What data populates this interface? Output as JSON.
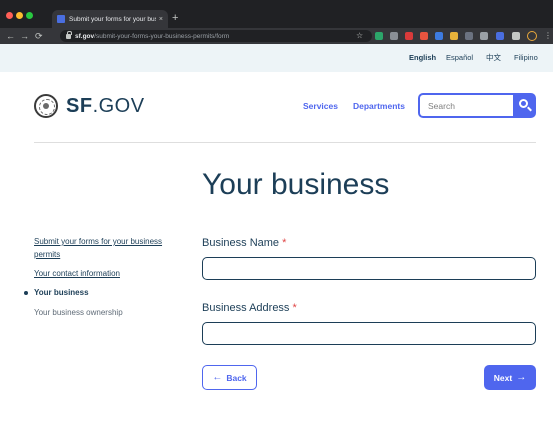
{
  "browser": {
    "tab_title": "Submit your forms for your bus",
    "tab_close": "×",
    "new_tab": "+",
    "url_host": "sf.gov",
    "url_path": "/submit-your-forms-your-business-permits/form"
  },
  "header": {
    "languages": [
      {
        "label": "English",
        "active": true
      },
      {
        "label": "Español",
        "active": false
      },
      {
        "label": "中文",
        "active": false
      },
      {
        "label": "Filipino",
        "active": false
      }
    ],
    "logo_bold": "SF",
    "logo_rest": ".GOV",
    "nav": {
      "services": "Services",
      "departments": "Departments"
    },
    "search_placeholder": "Search"
  },
  "main": {
    "title": "Your business",
    "fields": {
      "business_name": {
        "label": "Business Name",
        "required": "*",
        "value": ""
      },
      "business_address": {
        "label": "Business Address",
        "required": "*",
        "value": ""
      }
    },
    "back_label": "Back",
    "next_label": "Next"
  },
  "sidebar": {
    "items": [
      {
        "label": "Submit your forms for your business permits",
        "state": "link"
      },
      {
        "label": "Your contact information",
        "state": "link"
      },
      {
        "label": "Your business",
        "state": "current"
      },
      {
        "label": "Your business ownership",
        "state": "future"
      }
    ]
  },
  "colors": {
    "accent": "#4f66ee",
    "text_primary": "#1c3e57",
    "required": "#e04646",
    "lang_bar": "#edf4f7"
  }
}
